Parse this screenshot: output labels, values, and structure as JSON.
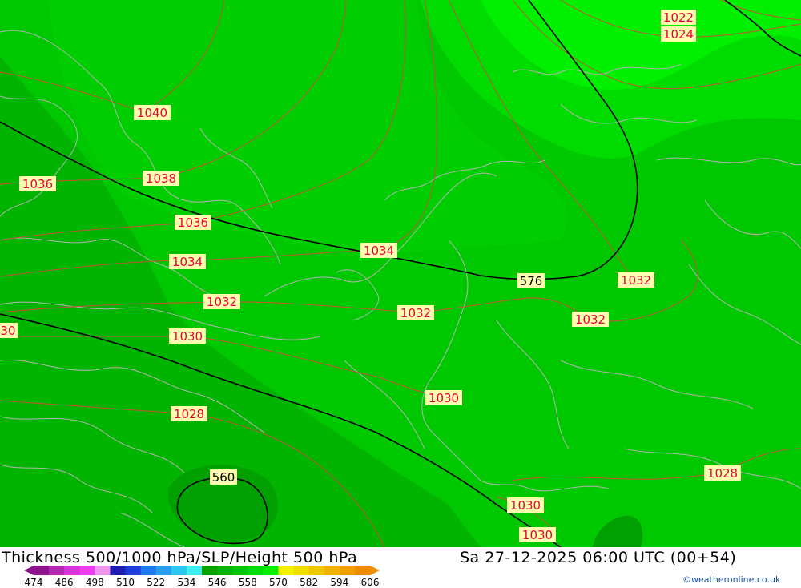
{
  "map": {
    "title": "Thickness 500/1000 hPa/SLP/Height 500 hPa",
    "datetime": "Sa 27-12-2025 06:00 UTC (00+54)",
    "credit": "©weatheronline.co.uk",
    "colors": {
      "band_534": "#00a000",
      "band_546": "#00b400",
      "band_558": "#00c800",
      "band_570": "#00dc00",
      "band_582": "#00f000",
      "isobar": "#e8003a",
      "height_contour": "#000000",
      "coastline": "#b4b4b4",
      "label_bg": "#ffffb0"
    },
    "isobar_labels": [
      "1022",
      "1024",
      "1040",
      "1036",
      "1038",
      "1036",
      "1034",
      "1034",
      "1032",
      "1032",
      "1032",
      "1032",
      "30",
      "1030",
      "1028",
      "1030",
      "1028",
      "1030",
      "1030",
      "1028"
    ],
    "height_labels": [
      "576",
      "560"
    ],
    "legend": {
      "ticks": [
        "474",
        "486",
        "498",
        "510",
        "522",
        "534",
        "546",
        "558",
        "570",
        "582",
        "594",
        "606"
      ],
      "colors": [
        "#8c148c",
        "#b428b4",
        "#dc32dc",
        "#f03cf0",
        "#f096f0",
        "#1e1eb4",
        "#1e3cdc",
        "#1e78f0",
        "#28a0f0",
        "#28c8f0",
        "#3cf0f0",
        "#00a000",
        "#00b400",
        "#00c800",
        "#00dc00",
        "#00f000",
        "#f0f000",
        "#f0dc00",
        "#f0c800",
        "#f0b400",
        "#f0a000",
        "#f08c00"
      ]
    }
  }
}
